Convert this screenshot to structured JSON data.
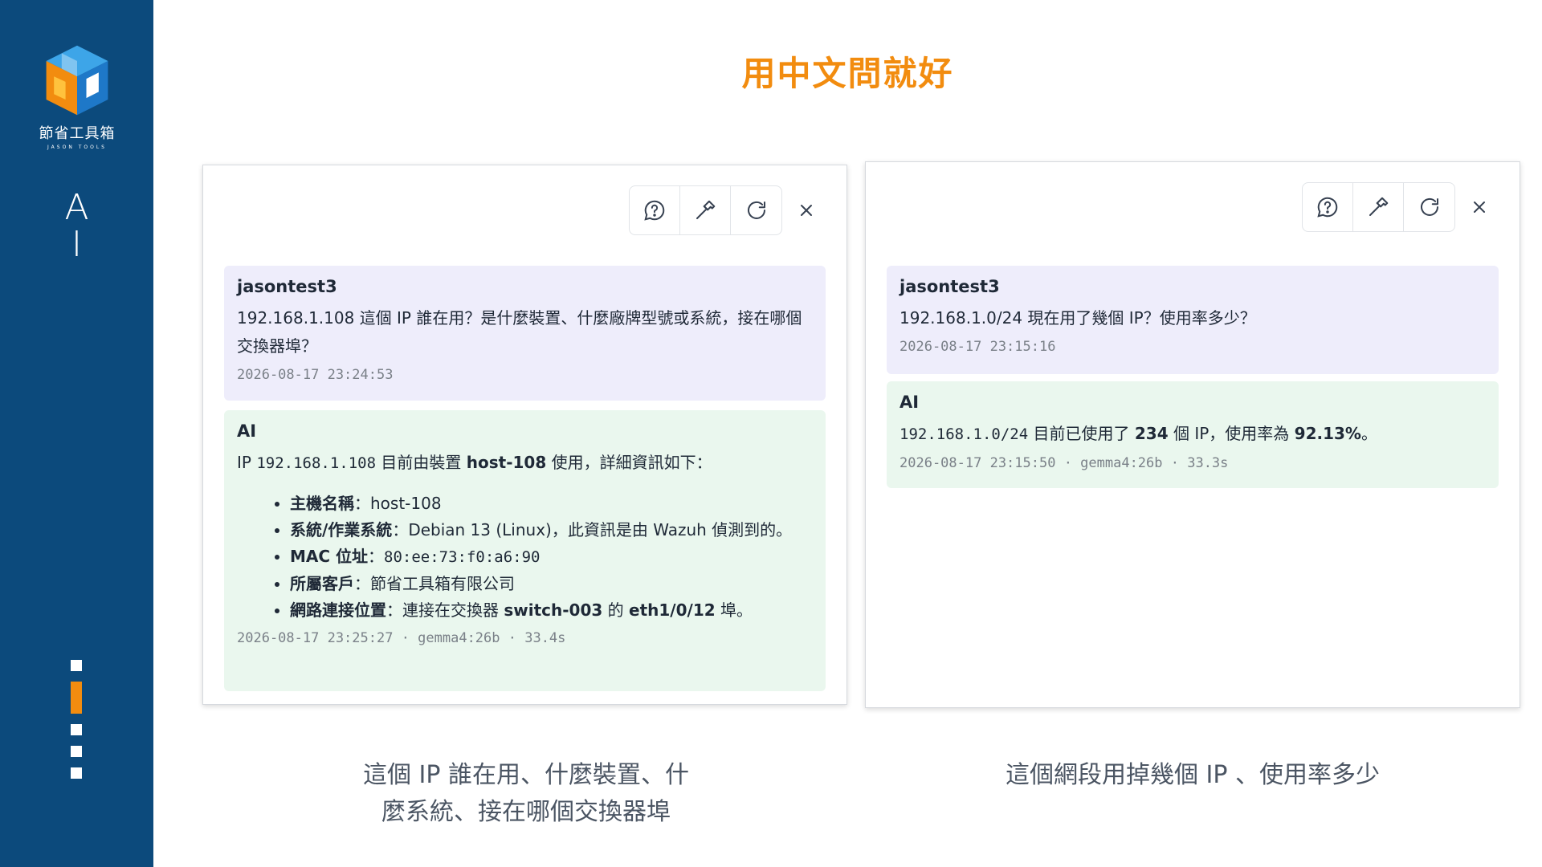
{
  "sidebar": {
    "logo_text": "節省工具箱",
    "logo_sub": "JASON TOOLS",
    "title_line1": "A",
    "title_line2": "I",
    "progress_total": 5,
    "progress_active_index": 1,
    "colors": {
      "background": "#0c4a7c",
      "accent": "#f28c0f"
    }
  },
  "page": {
    "title": "用中文問就好",
    "title_color": "#f28c0f"
  },
  "toolbar_icons": [
    "help-circle-icon",
    "hammer-icon",
    "refresh-icon",
    "close-icon"
  ],
  "left_panel": {
    "user": {
      "author": "jasontest3",
      "text": "192.168.1.108 這個 IP 誰在用？是什麼裝置、什麼廠牌型號或系統，接在哪個交換器埠？",
      "timestamp": "2026-08-17 23:24:53"
    },
    "ai": {
      "author": "AI",
      "intro_prefix": "IP ",
      "intro_ip": "192.168.1.108",
      "intro_mid": " 目前由裝置 ",
      "intro_host": "host-108",
      "intro_suffix": " 使用，詳細資訊如下：",
      "items": [
        {
          "label": "主機名稱",
          "sep": "：",
          "value": "host-108"
        },
        {
          "label": "系統/作業系統",
          "sep": "：",
          "value": "Debian 13 (Linux)，此資訊是由 Wazuh 偵測到的。"
        },
        {
          "label": "MAC 位址",
          "sep": "：",
          "value": "80:ee:73:f0:a6:90"
        },
        {
          "label": "所屬客戶",
          "sep": "：",
          "value": "節省工具箱有限公司"
        },
        {
          "label": "網路連接位置",
          "sep": "：",
          "value_a": "連接在交換器 ",
          "value_switch": "switch-003",
          "value_b": " 的 ",
          "value_port": "eth1/0/12",
          "value_c": " 埠。"
        }
      ],
      "meta": "2026-08-17 23:25:27 · gemma4:26b · 33.4s"
    }
  },
  "right_panel": {
    "user": {
      "author": "jasontest3",
      "text": "192.168.1.0/24 現在用了幾個 IP？使用率多少？",
      "timestamp": "2026-08-17 23:15:16"
    },
    "ai": {
      "author": "AI",
      "subnet": "192.168.1.0/24",
      "text_a": " 目前已使用了 ",
      "used": "234",
      "text_b": " 個 IP，使用率為 ",
      "rate": "92.13%",
      "text_c": "。",
      "meta": "2026-08-17 23:15:50 · gemma4:26b · 33.3s"
    }
  },
  "captions": {
    "left_line1": "這個 IP 誰在用、什麼裝置、什",
    "left_line2": "麼系統、接在哪個交換器埠",
    "right": "這個網段用掉幾個 IP 、使用率多少"
  }
}
